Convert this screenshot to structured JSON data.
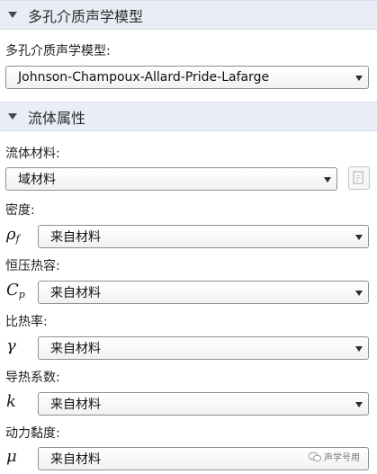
{
  "sections": {
    "porous_model": {
      "title": "多孔介质声学模型"
    },
    "fluid_props": {
      "title": "流体属性"
    }
  },
  "porous_model": {
    "label": "多孔介质声学模型:",
    "value": "Johnson-Champoux-Allard-Pride-Lafarge"
  },
  "fluid_material": {
    "label": "流体材料:",
    "value": "域材料"
  },
  "properties": {
    "density": {
      "label": "密度:",
      "symbol": "ρ",
      "subscript": "f",
      "value": "来自材料"
    },
    "heat_capacity": {
      "label": "恒压热容:",
      "symbol": "C",
      "subscript": "p",
      "value": "来自材料"
    },
    "heat_ratio": {
      "label": "比热率:",
      "symbol": "γ",
      "value": "来自材料"
    },
    "thermal_conductivity": {
      "label": "导热系数:",
      "symbol": "k",
      "value": "来自材料"
    },
    "dynamic_viscosity": {
      "label": "动力黏度:",
      "symbol": "μ",
      "value": "来自材料"
    }
  },
  "watermark": {
    "text": "声学号用"
  },
  "icons": {
    "section_toggle": "triangle-down-icon",
    "dropdown": "chevron-down-icon",
    "material_browse": "document-icon"
  }
}
